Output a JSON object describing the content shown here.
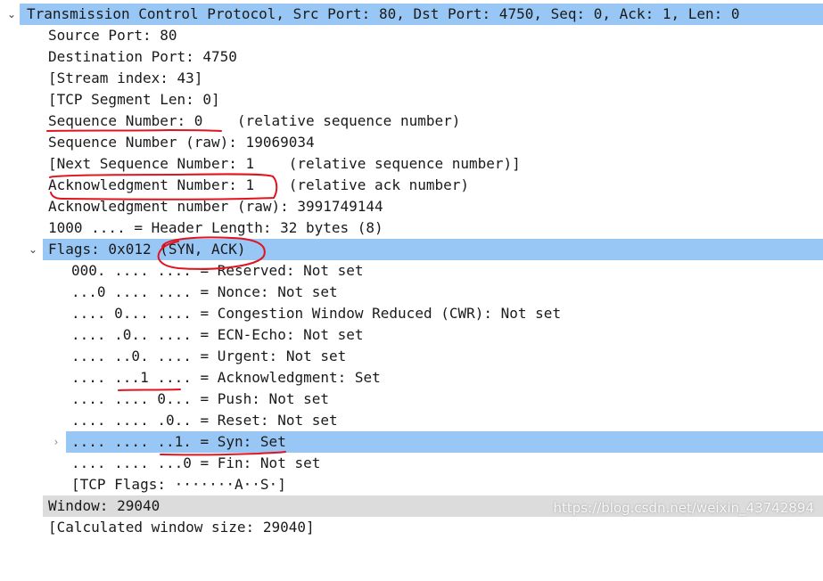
{
  "tree": {
    "rows": [
      {
        "text": "Transmission Control Protocol, Src Port: 80, Dst Port: 4750, Seq: 0, Ack: 1, Len: 0",
        "caret": "expanded"
      },
      {
        "text": "Source Port: 80"
      },
      {
        "text": "Destination Port: 4750"
      },
      {
        "text": "[Stream index: 43]"
      },
      {
        "text": "[TCP Segment Len: 0]"
      },
      {
        "text": "Sequence Number: 0    (relative sequence number)"
      },
      {
        "text": "Sequence Number (raw): 19069034"
      },
      {
        "text": "[Next Sequence Number: 1    (relative sequence number)]"
      },
      {
        "text": "Acknowledgment Number: 1    (relative ack number)"
      },
      {
        "text": "Acknowledgment number (raw): 3991749144"
      },
      {
        "text": "1000 .... = Header Length: 32 bytes (8)"
      },
      {
        "text": "Flags: 0x012 (SYN, ACK)",
        "caret": "expanded"
      },
      {
        "text": "000. .... .... = Reserved: Not set"
      },
      {
        "text": "...0 .... .... = Nonce: Not set"
      },
      {
        "text": ".... 0... .... = Congestion Window Reduced (CWR): Not set"
      },
      {
        "text": ".... .0.. .... = ECN-Echo: Not set"
      },
      {
        "text": ".... ..0. .... = Urgent: Not set"
      },
      {
        "text": ".... ...1 .... = Acknowledgment: Set"
      },
      {
        "text": ".... .... 0... = Push: Not set"
      },
      {
        "text": ".... .... .0.. = Reset: Not set"
      },
      {
        "text": ".... .... ..1. = Syn: Set",
        "caret": "collapsed"
      },
      {
        "text": ".... .... ...0 = Fin: Not set"
      },
      {
        "text": "[TCP Flags: ·······A··S·]"
      },
      {
        "text": "Window: 29040"
      },
      {
        "text": "[Calculated window size: 29040]"
      }
    ]
  },
  "watermark": "https://blog.csdn.net/weixin_43742894",
  "colors": {
    "selection": "#99c7f5",
    "hover": "#dcdcdc",
    "annotation": "#e0141e"
  }
}
